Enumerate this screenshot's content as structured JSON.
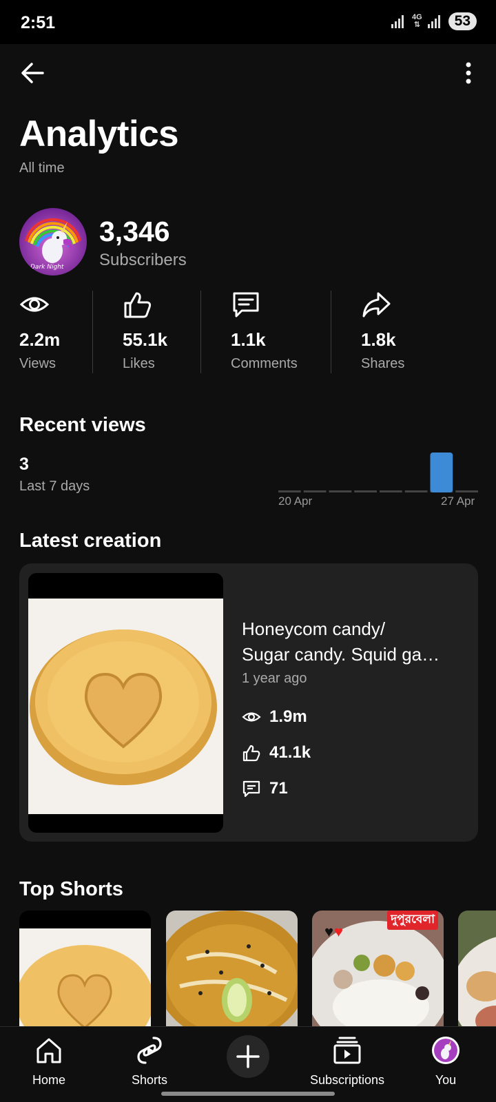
{
  "status_bar": {
    "time": "2:51",
    "network": "4G",
    "battery": "53"
  },
  "header": {
    "title": "Analytics",
    "subtitle": "All time"
  },
  "channel": {
    "avatar_text": "Dark Night",
    "subscriber_count": "3,346",
    "subscriber_label": "Subscribers"
  },
  "stats": [
    {
      "icon": "eye-icon",
      "value": "2.2m",
      "label": "Views"
    },
    {
      "icon": "thumbs-up-icon",
      "value": "55.1k",
      "label": "Likes"
    },
    {
      "icon": "comment-icon",
      "value": "1.1k",
      "label": "Comments"
    },
    {
      "icon": "share-icon",
      "value": "1.8k",
      "label": "Shares"
    }
  ],
  "recent_views": {
    "title": "Recent views",
    "count": "3",
    "period": "Last 7 days",
    "tick_start": "20 Apr",
    "tick_end": "27 Apr",
    "daily_views": [
      0,
      0,
      0,
      0,
      0,
      0,
      3,
      0
    ],
    "bar_color": "#3d8ad6"
  },
  "latest_creation": {
    "title": "Latest creation",
    "video_title_line1": "Honeycom candy/",
    "video_title_line2": "Sugar candy. Squid ga…",
    "age": "1 year ago",
    "views": "1.9m",
    "likes": "41.1k",
    "comments": "71"
  },
  "top_shorts": {
    "title": "Top Shorts",
    "items": [
      {
        "kind": "honeycomb-candy"
      },
      {
        "kind": "curry-dish"
      },
      {
        "kind": "bengali-lunch-plate",
        "overlay_text": "দুপুরবেলা"
      },
      {
        "kind": "food-plate"
      }
    ]
  },
  "bottom_nav": {
    "home": "Home",
    "shorts": "Shorts",
    "create": "+",
    "subscriptions": "Subscriptions",
    "you": "You"
  }
}
